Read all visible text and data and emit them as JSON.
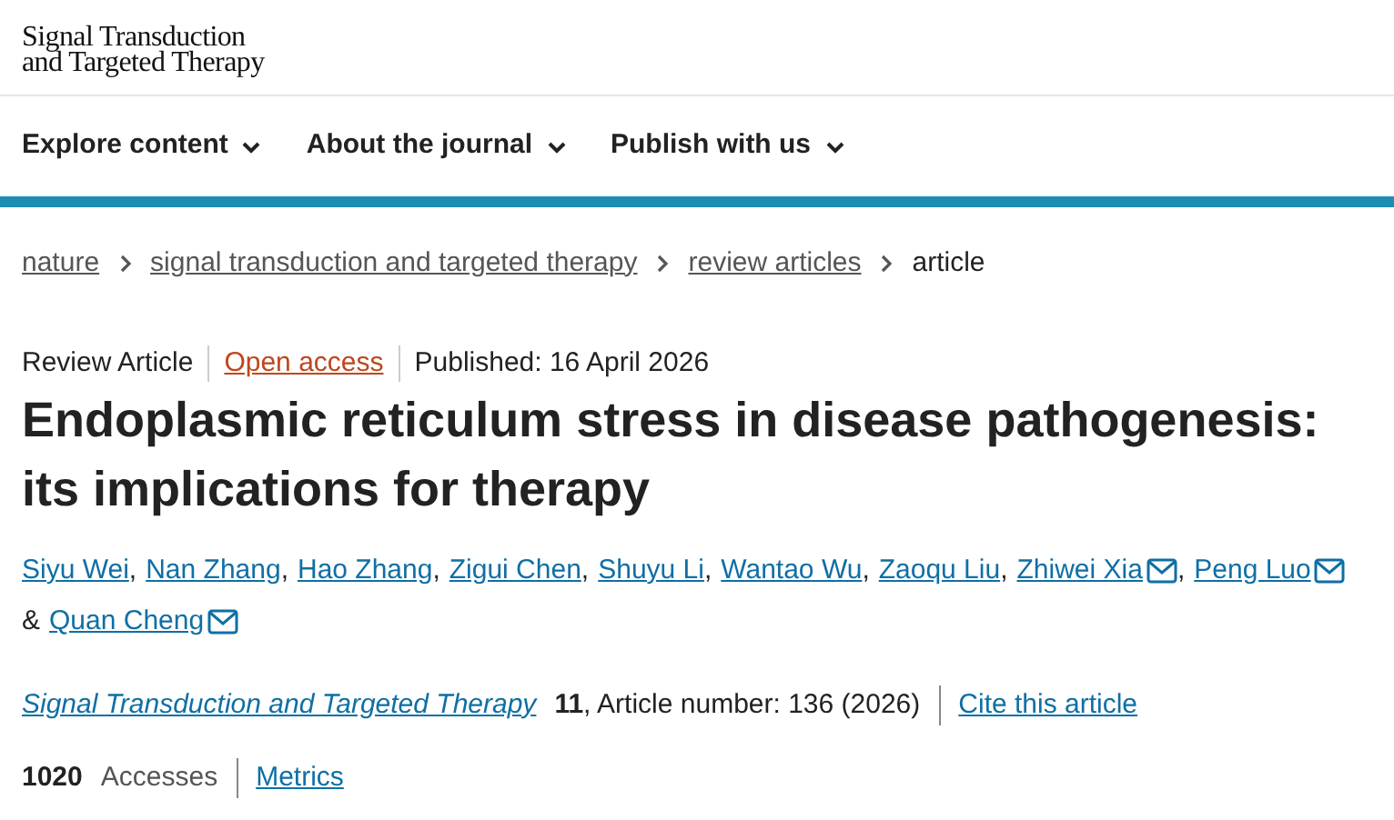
{
  "logo": {
    "lines": [
      "Signal Transduction",
      "and Targeted Therapy"
    ]
  },
  "nav": [
    {
      "label": "Explore content"
    },
    {
      "label": "About the journal"
    },
    {
      "label": "Publish with us"
    }
  ],
  "breadcrumbs": [
    {
      "label": "nature",
      "current": false
    },
    {
      "label": "signal transduction and targeted therapy",
      "current": false
    },
    {
      "label": "review articles",
      "current": false
    },
    {
      "label": "article",
      "current": true
    }
  ],
  "meta": [
    {
      "kind": "text",
      "text": "Review Article"
    },
    {
      "kind": "link",
      "text": "Open access"
    },
    {
      "kind": "text",
      "text": "Published: 16 April 2026"
    }
  ],
  "title": "Endoplasmic reticulum stress in disease pathogenesis: its implications for therapy",
  "authors": [
    {
      "name": "Siyu Wei",
      "email": false,
      "suffix": ","
    },
    {
      "name": "Nan Zhang",
      "email": false,
      "suffix": ","
    },
    {
      "name": "Hao Zhang",
      "email": false,
      "suffix": ","
    },
    {
      "name": "Zigui Chen",
      "email": false,
      "suffix": ","
    },
    {
      "name": "Shuyu Li",
      "email": false,
      "suffix": ","
    },
    {
      "name": "Wantao Wu",
      "email": false,
      "suffix": ","
    },
    {
      "name": "Zaoqu Liu",
      "email": false,
      "suffix": ","
    },
    {
      "name": "Zhiwei Xia",
      "email": true,
      "suffix": ","
    },
    {
      "name": "Peng Luo",
      "email": true
    },
    {
      "conjunction": "&",
      "name": "Quan Cheng",
      "email": true
    }
  ],
  "citation": {
    "journal": "Signal Transduction and Targeted Therapy",
    "details": "**11**, Article number: 136 (2026)",
    "cite_link": "Cite this article"
  },
  "metrics": {
    "count": "1020",
    "label": "Accesses",
    "link": "Metrics"
  }
}
